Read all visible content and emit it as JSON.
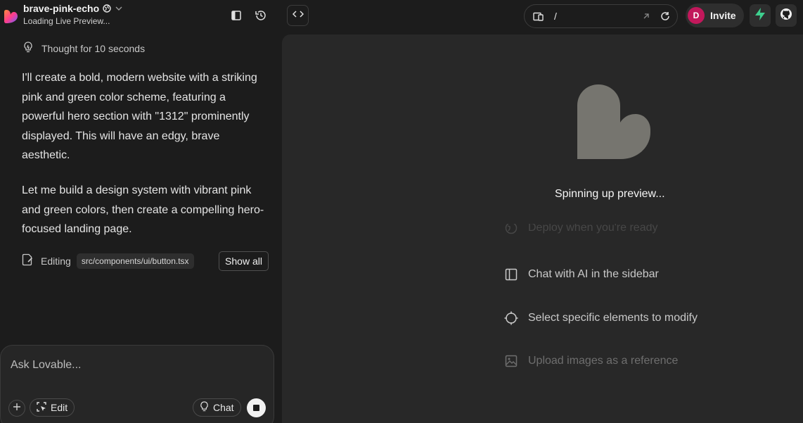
{
  "header": {
    "project_name": "brave-pink-echo",
    "status": "Loading Live Preview...",
    "url_path": "/",
    "avatar_initial": "D",
    "invite_label": "Invite"
  },
  "chat": {
    "thought": "Thought for 10 seconds",
    "messages": [
      "I'll create a bold, modern website with a striking pink and green color scheme, featuring a powerful hero section with \"1312\" prominently displayed. This will have an edgy, brave aesthetic.",
      "Let me build a design system with vibrant pink and green colors, then create a compelling hero-focused landing page."
    ],
    "editing_label": "Editing",
    "editing_file": "src/components/ui/button.tsx",
    "show_all_label": "Show all"
  },
  "composer": {
    "placeholder": "Ask Lovable...",
    "edit_label": "Edit",
    "chat_label": "Chat"
  },
  "preview": {
    "spinning_text": "Spinning up preview...",
    "features": [
      "Deploy when you're ready",
      "Chat with AI in the sidebar",
      "Select specific elements to modify",
      "Upload images as a reference"
    ]
  },
  "colors": {
    "background": "#1c1c1c",
    "preview_background": "#282828",
    "heart": "#76756f",
    "avatar": "#c2185b",
    "supabase_green": "#3ecf8e"
  },
  "icons": [
    "lovable-logo",
    "globe-icon",
    "chevron-down-icon",
    "sidebar-toggle-icon",
    "history-icon",
    "code-icon",
    "device-icon",
    "external-link-icon",
    "refresh-icon",
    "supabase-icon",
    "github-icon",
    "lightbulb-icon",
    "edit-file-icon",
    "plus-icon",
    "select-icon",
    "stop-icon",
    "globe-deploy-icon",
    "sidebar-icon",
    "target-icon",
    "image-icon"
  ]
}
